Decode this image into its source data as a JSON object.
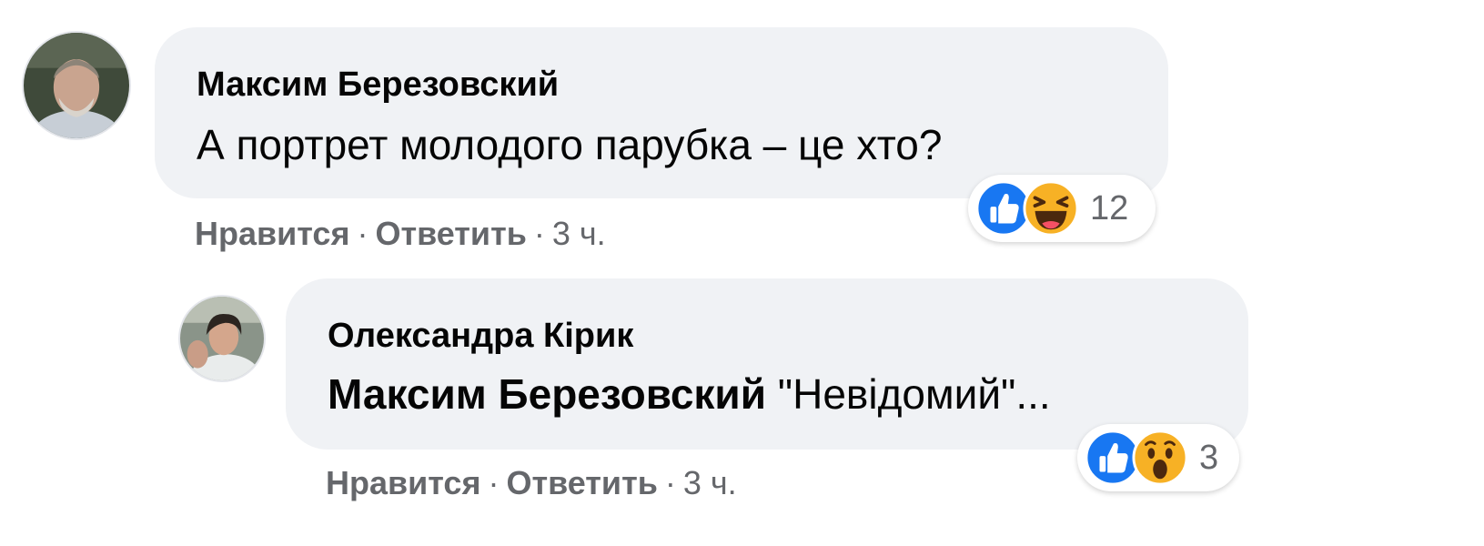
{
  "comments": [
    {
      "author": "Максим Березовский",
      "text": "А портрет молодого парубка – це хто?",
      "reactions": {
        "icons": [
          "like-icon",
          "haha-icon"
        ],
        "count": "12"
      },
      "actions": {
        "like": "Нравится",
        "reply": "Ответить",
        "sep": "·",
        "time": "3 ч."
      }
    },
    {
      "author": "Олександра Кірик",
      "mention": "Максим Березовский",
      "text": " \"Невідомий\"...",
      "reactions": {
        "icons": [
          "like-icon",
          "wow-icon"
        ],
        "count": "3"
      },
      "actions": {
        "like": "Нравится",
        "reply": "Ответить",
        "sep": "·",
        "time": "3 ч."
      }
    }
  ],
  "colors": {
    "bubble": "#f0f2f5",
    "text": "#050505",
    "secondary": "#65676b",
    "like_blue": "#1877f2",
    "emoji_yellow": "#f7b125"
  }
}
